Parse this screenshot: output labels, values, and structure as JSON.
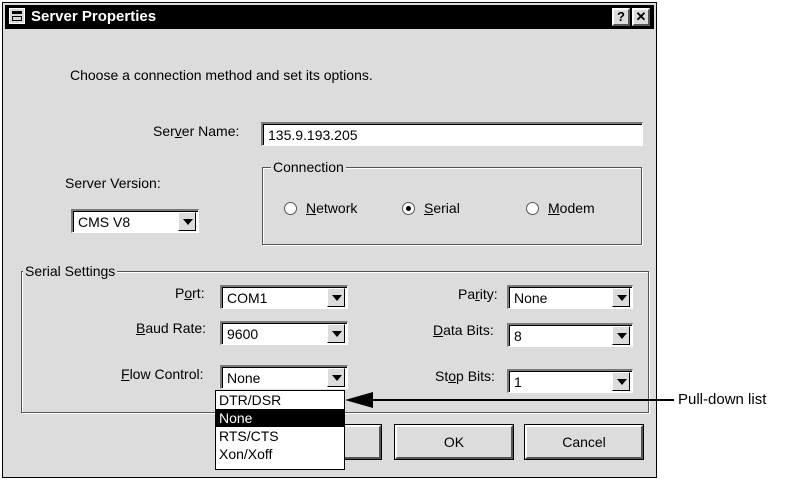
{
  "window": {
    "title": "Server Properties",
    "help_button": "?",
    "close_button": "✕"
  },
  "instructions": "Choose a connection method and set its options.",
  "server_name": {
    "label_pre": "Ser",
    "label_mnemonic": "v",
    "label_post": "er Name:",
    "value": "135.9.193.205"
  },
  "server_version": {
    "label": "Server Version:",
    "value": "CMS V8"
  },
  "connection": {
    "legend": "Connection",
    "options": [
      {
        "mnemonic": "N",
        "rest": "etwork",
        "selected": false
      },
      {
        "mnemonic": "S",
        "rest": "erial",
        "selected": true
      },
      {
        "mnemonic": "M",
        "rest": "odem",
        "selected": false
      }
    ]
  },
  "serial_settings": {
    "legend": "Serial Settings",
    "port": {
      "label_pre": "P",
      "label_mnemonic": "o",
      "label_post": "rt:",
      "value": "COM1"
    },
    "baud_rate": {
      "label_pre": "",
      "label_mnemonic": "B",
      "label_post": "aud Rate:",
      "value": "9600"
    },
    "flow_control": {
      "label_pre": "",
      "label_mnemonic": "F",
      "label_post": "low Control:",
      "value": "None"
    },
    "parity": {
      "label_pre": "Pa",
      "label_mnemonic": "r",
      "label_post": "ity:",
      "value": "None"
    },
    "data_bits": {
      "label_pre": "",
      "label_mnemonic": "D",
      "label_post": "ata Bits:",
      "value": "8"
    },
    "stop_bits": {
      "label_pre": "St",
      "label_mnemonic": "o",
      "label_post": "p Bits:",
      "value": "1"
    }
  },
  "dropdown": {
    "options": [
      "DTR/DSR",
      "None",
      "RTS/CTS",
      "Xon/Xoff"
    ],
    "selected": "None"
  },
  "buttons": {
    "ok": "OK",
    "cancel": "Cancel"
  },
  "callout": {
    "label": "Pull-down list"
  }
}
